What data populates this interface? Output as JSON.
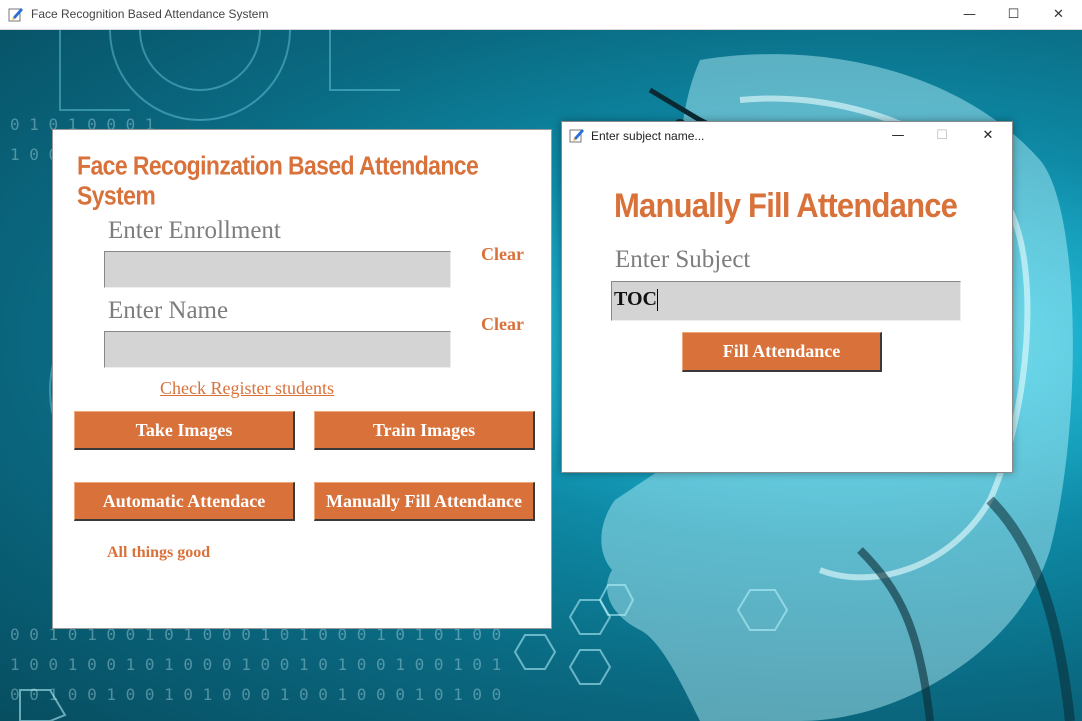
{
  "window": {
    "title": "Face Recognition Based Attendance System"
  },
  "panel": {
    "title": "Face Recoginzation Based Attendance System",
    "enrollment_label": "Enter Enrollment",
    "enrollment_value": "",
    "name_label": "Enter Name",
    "name_value": "",
    "clear_label": "Clear",
    "check_register_link": "Check Register students",
    "take_images_label": "Take Images",
    "train_images_label": "Train Images",
    "automatic_attendance_label": "Automatic Attendace",
    "manual_attendance_label": "Manually Fill Attendance",
    "status_text": "All things good"
  },
  "dialog": {
    "title": "Enter subject name...",
    "heading": "Manually Fill Attendance",
    "subject_label": "Enter Subject",
    "subject_value": "TOC",
    "fill_button_label": "Fill Attendance"
  },
  "colors": {
    "accent": "#d9713a",
    "field_bg": "#d4d4d4",
    "label_gray": "#7d7d7d"
  },
  "icons": [
    "app-icon",
    "minimize-icon",
    "maximize-icon",
    "close-icon"
  ]
}
